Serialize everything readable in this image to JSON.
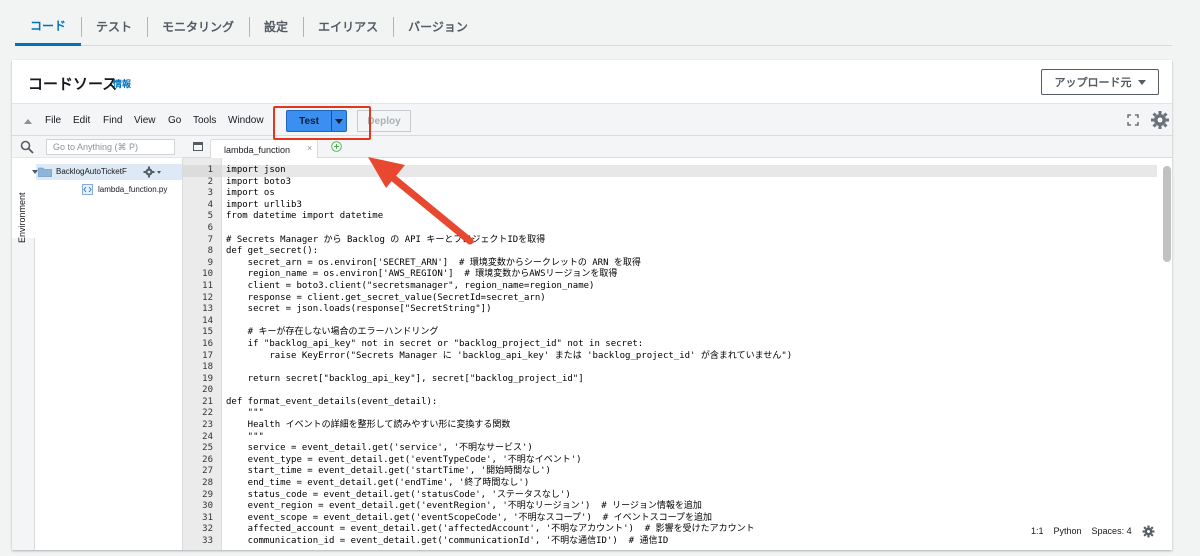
{
  "tabs": [
    {
      "label": "コード",
      "active": true
    },
    {
      "label": "テスト",
      "active": false
    },
    {
      "label": "モニタリング",
      "active": false
    },
    {
      "label": "設定",
      "active": false
    },
    {
      "label": "エイリアス",
      "active": false
    },
    {
      "label": "バージョン",
      "active": false
    }
  ],
  "panel": {
    "title": "コードソース",
    "info_link": "情報",
    "upload_label": "アップロード元"
  },
  "toolbar": {
    "menus": [
      "File",
      "Edit",
      "Find",
      "View",
      "Go",
      "Tools",
      "Window"
    ],
    "test_label": "Test",
    "deploy_label": "Deploy"
  },
  "sidebar": {
    "search_placeholder": "Go to Anything (⌘ P)",
    "env_label": "Environment",
    "folder_label": "BacklogAutoTicketF",
    "file_label": "lambda_function.py"
  },
  "editor": {
    "tab_label": "lambda_function",
    "close_glyph": "×"
  },
  "code_lines": [
    "import json",
    "import boto3",
    "import os",
    "import urllib3",
    "from datetime import datetime",
    "",
    "# Secrets Manager から Backlog の API キーとプロジェクトIDを取得",
    "def get_secret():",
    "    secret_arn = os.environ['SECRET_ARN']  # 環境変数からシークレットの ARN を取得",
    "    region_name = os.environ['AWS_REGION']  # 環境変数からAWSリージョンを取得",
    "    client = boto3.client(\"secretsmanager\", region_name=region_name)",
    "    response = client.get_secret_value(SecretId=secret_arn)",
    "    secret = json.loads(response[\"SecretString\"])",
    "",
    "    # キーが存在しない場合のエラーハンドリング",
    "    if \"backlog_api_key\" not in secret or \"backlog_project_id\" not in secret:",
    "        raise KeyError(\"Secrets Manager に 'backlog_api_key' または 'backlog_project_id' が含まれていません\")",
    "",
    "    return secret[\"backlog_api_key\"], secret[\"backlog_project_id\"]",
    "",
    "def format_event_details(event_detail):",
    "    \"\"\"",
    "    Health イベントの詳細を整形して読みやすい形に変換する関数",
    "    \"\"\"",
    "    service = event_detail.get('service', '不明なサービス')",
    "    event_type = event_detail.get('eventTypeCode', '不明なイベント')",
    "    start_time = event_detail.get('startTime', '開始時間なし')",
    "    end_time = event_detail.get('endTime', '終了時間なし')",
    "    status_code = event_detail.get('statusCode', 'ステータスなし')",
    "    event_region = event_detail.get('eventRegion', '不明なリージョン')  # リージョン情報を追加",
    "    event_scope = event_detail.get('eventScopeCode', '不明なスコープ')  # イベントスコープを追加",
    "    affected_account = event_detail.get('affectedAccount', '不明なアカウント')  # 影響を受けたアカウント",
    "    communication_id = event_detail.get('communicationId', '不明な通信ID')  # 通信ID"
  ],
  "status_bar": {
    "position": "1:1",
    "language": "Python",
    "spaces": "Spaces: 4"
  },
  "colors": {
    "accent": "#0073bb",
    "test_button": "#3b8ff0",
    "annotation": "#e4361d"
  }
}
